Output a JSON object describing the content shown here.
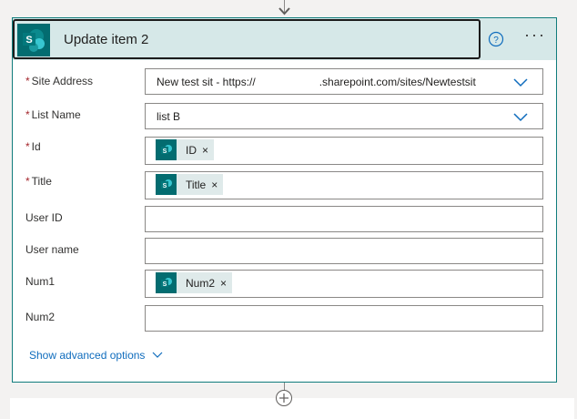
{
  "action": {
    "title": "Update item 2",
    "icons": {
      "logo": "sharepoint-icon",
      "help": "question-circle-icon",
      "more": "ellipsis-icon"
    },
    "more_label": "···"
  },
  "fields": {
    "site_address": {
      "label": "Site Address",
      "required": "*",
      "value": "New test sit - https://                     .sharepoint.com/sites/Newtestsit"
    },
    "list_name": {
      "label": "List Name",
      "required": "*",
      "value": "list B"
    },
    "id": {
      "label": "Id",
      "required": "*",
      "token": "ID"
    },
    "title": {
      "label": "Title",
      "required": "*",
      "token": "Title"
    },
    "user_id": {
      "label": "User ID",
      "value": ""
    },
    "user_name": {
      "label": "User name",
      "value": ""
    },
    "num1": {
      "label": "Num1",
      "token": "Num2"
    },
    "num2": {
      "label": "Num2",
      "value": ""
    }
  },
  "token_remove_glyph": "×",
  "advanced_label": "Show advanced options",
  "colors": {
    "accent": "#036c70",
    "header_bg": "#d6e8e8",
    "link": "#0f6cbd",
    "required": "#a4262c"
  }
}
